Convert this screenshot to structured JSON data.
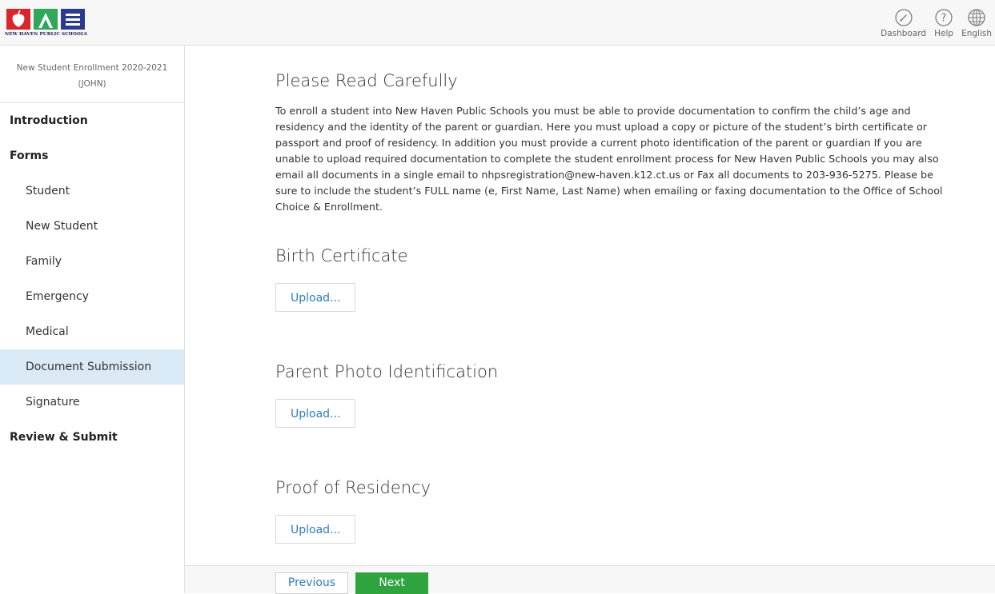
{
  "header": {
    "logo_text": "NEW HAVEN PUBLIC SCHOOLS",
    "nav": [
      {
        "label": "Dashboard",
        "icon": "dashboard-gauge-icon"
      },
      {
        "label": "Help",
        "icon": "help-question-icon"
      },
      {
        "label": "English",
        "icon": "globe-icon"
      }
    ]
  },
  "sidebar": {
    "title_line1": "New Student Enrollment 2020-2021",
    "title_line2": "(JOHN)",
    "items": [
      {
        "label": "Introduction",
        "level": "top"
      },
      {
        "label": "Forms",
        "level": "top"
      },
      {
        "label": "Student",
        "level": "sub"
      },
      {
        "label": "New Student",
        "level": "sub"
      },
      {
        "label": "Family",
        "level": "sub"
      },
      {
        "label": "Emergency",
        "level": "sub"
      },
      {
        "label": "Medical",
        "level": "sub"
      },
      {
        "label": "Document Submission",
        "level": "sub",
        "active": true
      },
      {
        "label": "Signature",
        "level": "sub"
      },
      {
        "label": "Review & Submit",
        "level": "top"
      }
    ]
  },
  "main": {
    "heading": "Please Read Carefully",
    "paragraph": "To enroll a student into New Haven Public Schools you must be able to provide documentation to confirm the child’s age and residency and the identity of the parent or guardian. Here you must upload a copy or picture of the student’s birth certificate or passport and proof of residency. In addition you must provide a current photo identification of the parent or guardian If you are unable to upload required documentation to complete the student enrollment process for New Haven Public Schools you may also email all documents in a single email to nhpsregistration@new-haven.k12.ct.us or Fax all documents to 203-936-5275. Please be sure to include the student’s FULL name (e, First Name, Last Name) when emailing or faxing documentation to the Office of School Choice & Enrollment.",
    "sections": [
      {
        "title": "Birth Certificate",
        "button": "Upload..."
      },
      {
        "title": "Parent Photo Identification",
        "button": "Upload..."
      },
      {
        "title": "Proof of Residency",
        "button": "Upload..."
      }
    ]
  },
  "footer": {
    "previous": "Previous",
    "next": "Next"
  },
  "colors": {
    "accent_blue": "#2e7cc0",
    "next_green": "#2fa43e",
    "active_bg": "#d9e9f5",
    "logo_red": "#d8262c",
    "logo_green": "#2ea85a",
    "logo_navy": "#2b3a8c"
  }
}
